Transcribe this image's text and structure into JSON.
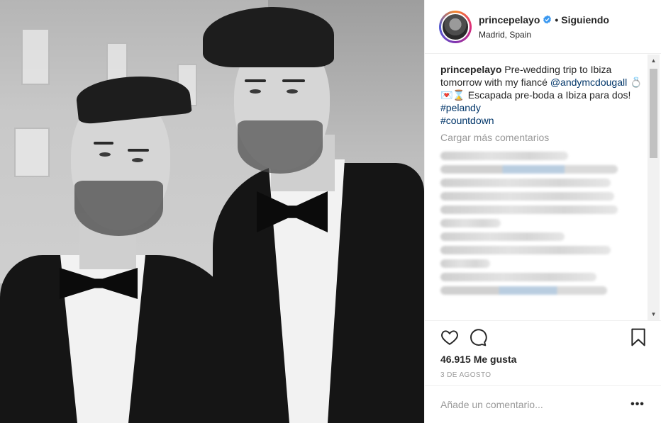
{
  "header": {
    "username": "princepelayo",
    "verified": true,
    "separator": "•",
    "follow_status": "Siguiendo",
    "location": "Madrid, Spain"
  },
  "caption": {
    "username": "princepelayo",
    "text_1": " Pre-wedding trip to Ibiza tomorrow with my fiancé ",
    "mention": "@andymcdougall",
    "emojis": "💍💌⌛",
    "text_2": " Escapada pre-boda a Ibiza para dos! ",
    "hashtag_1": "#pelandy",
    "hashtag_2": "#countdown"
  },
  "comments": {
    "load_more": "Cargar más comentarios"
  },
  "actions": {
    "like_icon": "heart-icon",
    "comment_icon": "speech-bubble-icon",
    "save_icon": "bookmark-icon"
  },
  "likes": "46.915 Me gusta",
  "date": "3 DE AGOSTO",
  "add_comment": {
    "placeholder": "Añade un comentario...",
    "more": "•••"
  },
  "colors": {
    "link": "#003569",
    "verified": "#3897f0",
    "muted": "#999999"
  }
}
